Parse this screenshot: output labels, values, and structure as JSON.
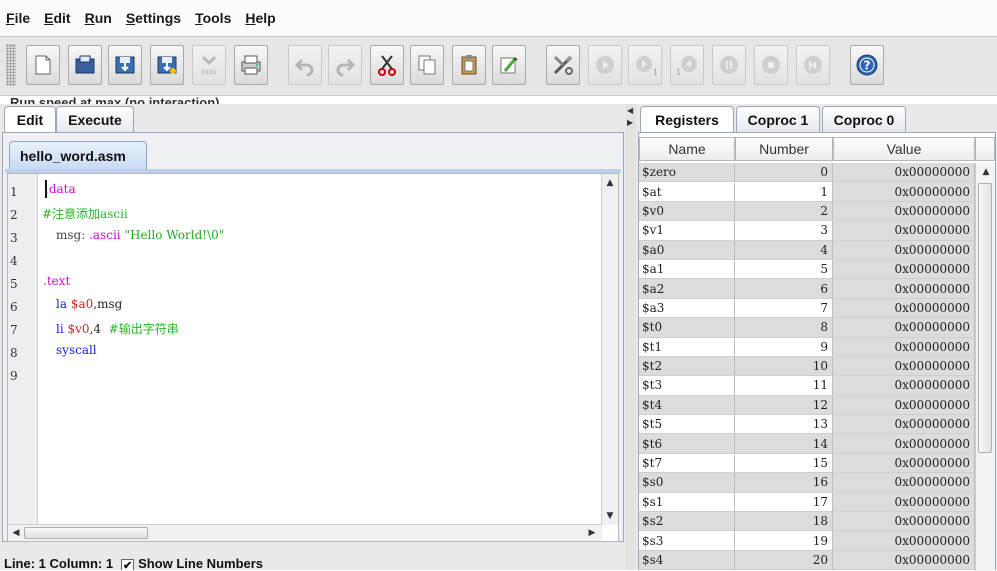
{
  "menu": [
    {
      "first": "F",
      "rest": "ile"
    },
    {
      "first": "E",
      "rest": "dit"
    },
    {
      "first": "R",
      "rest": "un"
    },
    {
      "first": "S",
      "rest": "ettings"
    },
    {
      "first": "T",
      "rest": "ools"
    },
    {
      "first": "H",
      "rest": "elp"
    }
  ],
  "toolbar": {
    "buttons": [
      {
        "name": "new-file-icon",
        "enabled": true
      },
      {
        "name": "open-file-icon",
        "enabled": true
      },
      {
        "name": "save-icon",
        "enabled": true
      },
      {
        "name": "save-as-icon",
        "enabled": true
      },
      {
        "name": "dump-memory-icon",
        "enabled": false
      },
      {
        "name": "print-icon",
        "enabled": true
      },
      {
        "name": "undo-icon",
        "enabled": false
      },
      {
        "name": "redo-icon",
        "enabled": false
      },
      {
        "name": "cut-icon",
        "enabled": true
      },
      {
        "name": "copy-icon",
        "enabled": true
      },
      {
        "name": "paste-icon",
        "enabled": true
      },
      {
        "name": "find-replace-icon",
        "enabled": true
      },
      {
        "name": "assemble-icon",
        "enabled": true
      },
      {
        "name": "run-icon",
        "enabled": false
      },
      {
        "name": "step-icon",
        "enabled": false
      },
      {
        "name": "backstep-icon",
        "enabled": false
      },
      {
        "name": "pause-icon",
        "enabled": false
      },
      {
        "name": "stop-icon",
        "enabled": false
      },
      {
        "name": "reset-icon",
        "enabled": false
      },
      {
        "name": "help-icon",
        "enabled": true
      }
    ],
    "dump_label": "0101",
    "step_badge": "1",
    "backstep_badge": "1",
    "run_speed": "Run speed at max (no interaction)"
  },
  "left": {
    "tabs": [
      "Edit",
      "Execute"
    ],
    "active_tab": "Edit",
    "file_tab": "hello_word.asm",
    "line_numbers": [
      "1",
      "2",
      "3",
      "4",
      "5",
      "6",
      "7",
      "8",
      "9"
    ],
    "status": {
      "line": "Line: 1 Column: 1",
      "show_line_numbers_label": "Show Line Numbers",
      "checked": true
    }
  },
  "code": {
    "l1": {
      "directive": ".data"
    },
    "l2": {
      "comment": "#注意添加ascii"
    },
    "l3": {
      "label": "msg:",
      "directive": ".ascii",
      "string": "\"Hello World!\\0\""
    },
    "l5": {
      "directive": ".text"
    },
    "l6": {
      "instr": "la",
      "reg": "$a0",
      "rest": ",msg"
    },
    "l7": {
      "instr": "li",
      "reg": "$v0",
      "rest": ",4",
      "comment": "#输出字符串"
    },
    "l8": {
      "instr": "syscall"
    }
  },
  "right": {
    "tabs": [
      "Registers",
      "Coproc 1",
      "Coproc 0"
    ],
    "active_tab": "Registers",
    "columns": [
      "Name",
      "Number",
      "Value"
    ],
    "registers": [
      {
        "name": "$zero",
        "number": "0",
        "value": "0x00000000"
      },
      {
        "name": "$at",
        "number": "1",
        "value": "0x00000000"
      },
      {
        "name": "$v0",
        "number": "2",
        "value": "0x00000000"
      },
      {
        "name": "$v1",
        "number": "3",
        "value": "0x00000000"
      },
      {
        "name": "$a0",
        "number": "4",
        "value": "0x00000000"
      },
      {
        "name": "$a1",
        "number": "5",
        "value": "0x00000000"
      },
      {
        "name": "$a2",
        "number": "6",
        "value": "0x00000000"
      },
      {
        "name": "$a3",
        "number": "7",
        "value": "0x00000000"
      },
      {
        "name": "$t0",
        "number": "8",
        "value": "0x00000000"
      },
      {
        "name": "$t1",
        "number": "9",
        "value": "0x00000000"
      },
      {
        "name": "$t2",
        "number": "10",
        "value": "0x00000000"
      },
      {
        "name": "$t3",
        "number": "11",
        "value": "0x00000000"
      },
      {
        "name": "$t4",
        "number": "12",
        "value": "0x00000000"
      },
      {
        "name": "$t5",
        "number": "13",
        "value": "0x00000000"
      },
      {
        "name": "$t6",
        "number": "14",
        "value": "0x00000000"
      },
      {
        "name": "$t7",
        "number": "15",
        "value": "0x00000000"
      },
      {
        "name": "$s0",
        "number": "16",
        "value": "0x00000000"
      },
      {
        "name": "$s1",
        "number": "17",
        "value": "0x00000000"
      },
      {
        "name": "$s2",
        "number": "18",
        "value": "0x00000000"
      },
      {
        "name": "$s3",
        "number": "19",
        "value": "0x00000000"
      },
      {
        "name": "$s4",
        "number": "20",
        "value": "0x00000000"
      }
    ]
  }
}
